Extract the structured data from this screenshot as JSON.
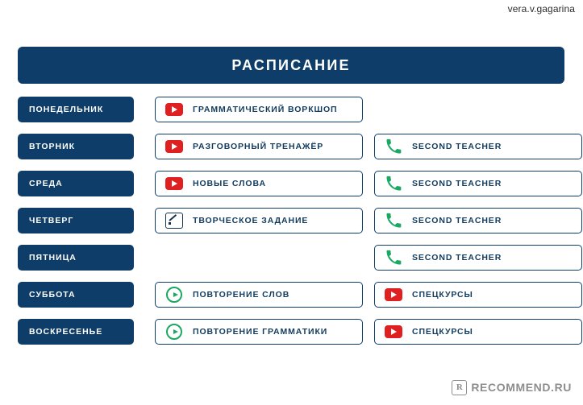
{
  "watermark_top": "vera.v.gagarina",
  "watermark_bottom": {
    "badge": "R",
    "text": "RECOMMEND.RU"
  },
  "header": {
    "title": "РАСПИСАНИЕ"
  },
  "rows": [
    {
      "day": "ПОНЕДЕЛЬНИК",
      "col2": {
        "label": "ГРАММАТИЧЕСКИЙ ВОРКШОП",
        "icon": "youtube-icon"
      },
      "col3": null
    },
    {
      "day": "ВТОРНИК",
      "col2": {
        "label": "РАЗГОВОРНЫЙ ТРЕНАЖЁР",
        "icon": "youtube-icon"
      },
      "col3": {
        "label": "SECOND TEACHER",
        "icon": "phone-icon"
      }
    },
    {
      "day": "СРЕДА",
      "col2": {
        "label": "НОВЫЕ СЛОВА",
        "icon": "youtube-icon"
      },
      "col3": {
        "label": "SECOND TEACHER",
        "icon": "phone-icon"
      }
    },
    {
      "day": "ЧЕТВЕРГ",
      "col2": {
        "label": "ТВОРЧЕСКОЕ ЗАДАНИЕ",
        "icon": "pencil-icon"
      },
      "col3": {
        "label": "SECOND TEACHER",
        "icon": "phone-icon"
      }
    },
    {
      "day": "ПЯТНИЦА",
      "col2": null,
      "col3": {
        "label": "SECOND TEACHER",
        "icon": "phone-icon"
      }
    },
    {
      "day": "СУББОТА",
      "col2": {
        "label": "ПОВТОРЕНИЕ СЛОВ",
        "icon": "refresh-icon"
      },
      "col3": {
        "label": "СПЕЦКУРСЫ",
        "icon": "youtube-icon"
      }
    },
    {
      "day": "ВОСКРЕСЕНЬЕ",
      "col2": {
        "label": "ПОВТОРЕНИЕ ГРАММАТИКИ",
        "icon": "refresh-icon"
      },
      "col3": {
        "label": "СПЕЦКУРСЫ",
        "icon": "youtube-icon"
      }
    }
  ],
  "colors": {
    "navy": "#0d3d68",
    "youtube_red": "#e02020",
    "green": "#1aa963",
    "text_navy": "#123b5e"
  }
}
